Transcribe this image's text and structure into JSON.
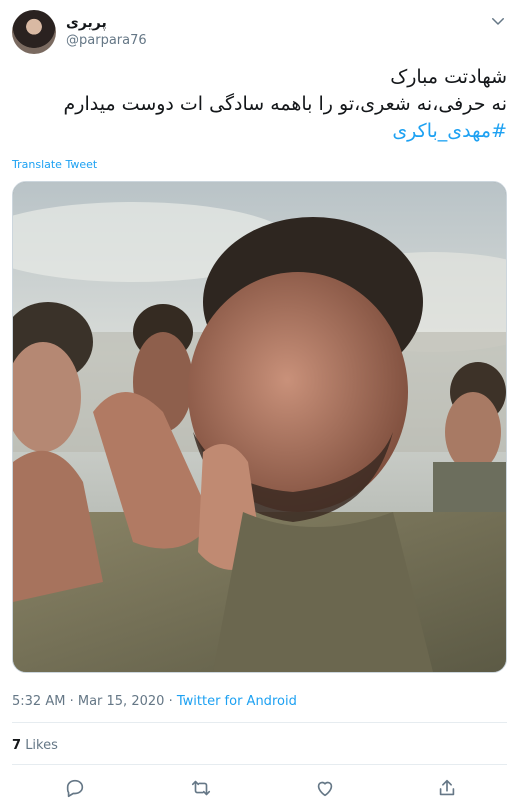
{
  "author": {
    "display_name": "پریری",
    "handle": "@parpara76"
  },
  "tweet": {
    "line1": "شهادتت مبارک",
    "line2": "نه حرفی،نه شعری،تو را باهمه سادگی ات دوست میدارم",
    "hashtag": "#مهدی_باکری"
  },
  "translate_label": "Translate Tweet",
  "meta": {
    "time": "5:32 AM",
    "sep": "·",
    "date": "Mar 15, 2020",
    "source": "Twitter for Android"
  },
  "likes": {
    "count": "7",
    "label": "Likes"
  },
  "icons": {
    "more": "chevron-down-icon",
    "reply": "reply-icon",
    "retweet": "retweet-icon",
    "like": "heart-icon",
    "share": "share-icon"
  },
  "colors": {
    "accent": "#1da1f2",
    "secondary_text": "#657786",
    "divider": "#e6ecf0"
  }
}
